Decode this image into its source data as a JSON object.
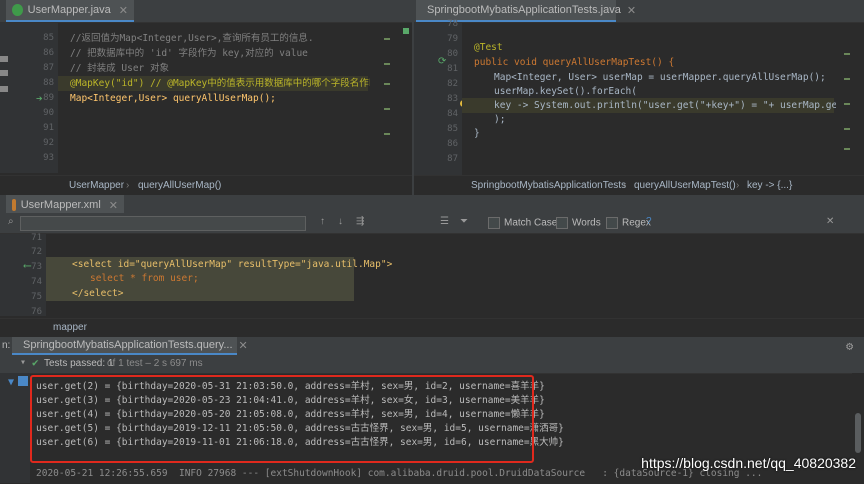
{
  "left_editor": {
    "tab_label": "UserMapper.java",
    "line_numbers": [
      "85",
      "86",
      "87",
      "88",
      "89",
      "90",
      "91",
      "92",
      "93",
      "94",
      "95",
      "96",
      "97"
    ],
    "lines": [
      "//返回值为Map<Integer,User>,查询所有员工的信息.",
      "// 把数据库中的 'id' 字段作为 key,对应的 value",
      "// 封装成 User 对象",
      "@MapKey(\"id\") // @MapKey中的值表示用数据库中的哪个字段名作key",
      "Map<Integer,User> queryAllUserMap();"
    ],
    "breadcrumb": [
      "UserMapper",
      "queryAllUserMap()"
    ]
  },
  "right_editor": {
    "tab_label": "SpringbootMybatisApplicationTests.java",
    "line_numbers": [
      "78",
      "79",
      "80",
      "81",
      "82",
      "83",
      "84",
      "85",
      "86",
      "87",
      "88",
      "89",
      "90",
      "91",
      "92",
      "93",
      "94",
      "95",
      "96",
      "97"
    ],
    "lines": {
      "annotation": "@Test",
      "method_sig": "public void queryAllUserMapTest() {",
      "l1": "Map<Integer, User> userMap = userMapper.queryAllUserMap();",
      "l2": "userMap.keySet().forEach(",
      "l3": "key -> System.out.println(\"user.get(\"+key+\") = \"+ userMap.get(key))",
      "l4": ");",
      "l5": "}"
    },
    "breadcrumb": [
      "SpringbootMybatisApplicationTests",
      "queryAllUserMapTest()",
      "key -> {...}"
    ]
  },
  "xml_editor": {
    "tab_label": "UserMapper.xml",
    "search": {
      "match_case": "Match Case",
      "words": "Words",
      "regex": "Regex",
      "help": "?"
    },
    "line_numbers": [
      "71",
      "72",
      "73",
      "74",
      "75",
      "76"
    ],
    "lines": {
      "l73": "<select id=\"queryAllUserMap\" resultType=\"java.util.Map\">",
      "l74": "select * from user;",
      "l75": "</select>"
    },
    "breadcrumb": "mapper"
  },
  "run_panel": {
    "side_label": "n:",
    "tab_label": "SpringbootMybatisApplicationTests.query...",
    "status": "Tests passed: 1",
    "status_detail": "of 1 test – 2 s 697 ms",
    "output": [
      "user.get(2) = {birthday=2020-05-31 21:03:50.0, address=羊村, sex=男, id=2, username=喜羊羊}",
      "user.get(3) = {birthday=2020-05-23 21:04:41.0, address=羊村, sex=女, id=3, username=美羊羊}",
      "user.get(4) = {birthday=2020-05-20 21:05:08.0, address=羊村, sex=男, id=4, username=懒羊羊}",
      "user.get(5) = {birthday=2019-12-11 21:05:50.0, address=古古怪界, sex=男, id=5, username=潇洒哥}",
      "user.get(6) = {birthday=2019-11-01 21:06:18.0, address=古古怪界, sex=男, id=6, username=黑大帅}"
    ],
    "log_line": "2020-05-21 12:26:55.659  INFO 27968 --- [extShutdownHook] com.alibaba.druid.pool.DruidDataSource   : {dataSource-1} closing ...",
    "highlight_color": "#e0291d"
  },
  "watermark": "https://blog.csdn.net/qq_40820382"
}
